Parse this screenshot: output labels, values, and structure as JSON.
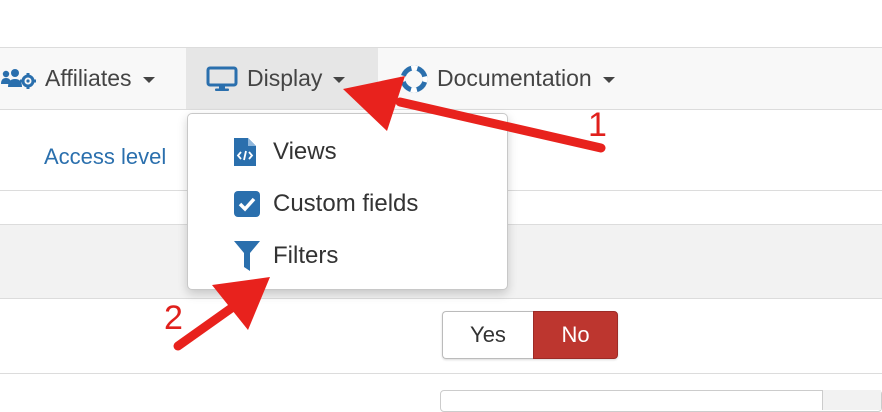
{
  "nav": {
    "affiliates": "Affiliates",
    "display": "Display",
    "documentation": "Documentation"
  },
  "access_link": "Access level",
  "dropdown": {
    "items": [
      {
        "label": "Views",
        "icon": "file-code-icon"
      },
      {
        "label": "Custom fields",
        "icon": "checkbox-icon"
      },
      {
        "label": "Filters",
        "icon": "filter-icon"
      }
    ]
  },
  "toggle": {
    "yes": "Yes",
    "no": "No",
    "selected": "No"
  },
  "annotations": {
    "first": "1",
    "second": "2"
  },
  "colors": {
    "accent": "#2a6fad",
    "no_active": "#bd362f",
    "arrow": "#e0201c"
  }
}
